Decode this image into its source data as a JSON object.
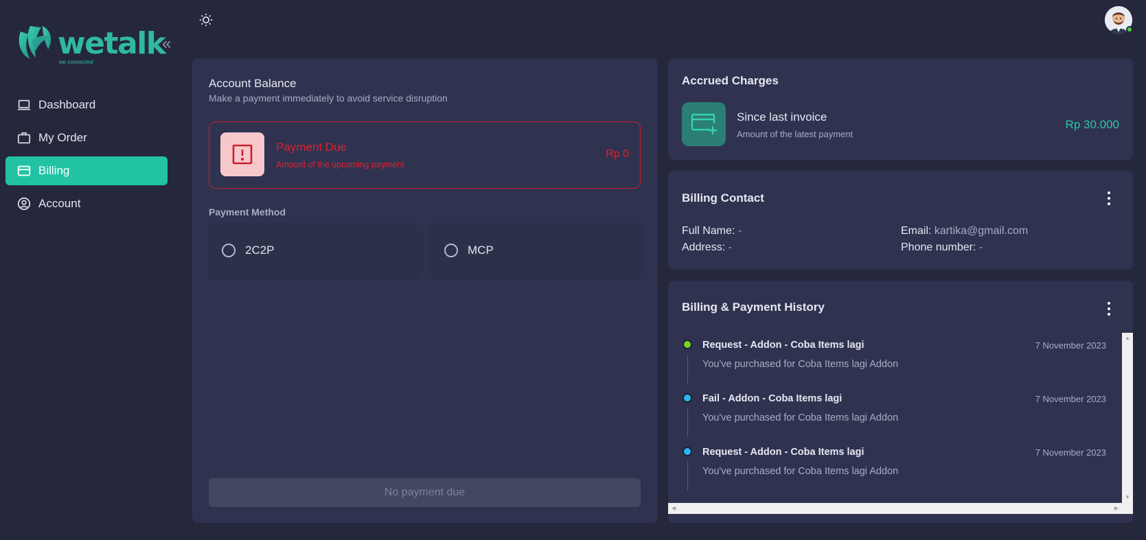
{
  "brand": {
    "name": "wetalk",
    "tagline": "we connected",
    "color": "#2fb9a3"
  },
  "sidebar": {
    "collapse_icon": "double-chevron-left-icon",
    "items": [
      {
        "label": "Dashboard",
        "icon": "laptop-icon",
        "active": false
      },
      {
        "label": "My Order",
        "icon": "briefcase-icon",
        "active": false
      },
      {
        "label": "Billing",
        "icon": "credit-card-icon",
        "active": true
      },
      {
        "label": "Account",
        "icon": "user-circle-icon",
        "active": false
      }
    ]
  },
  "topbar": {
    "theme_icon": "sun-icon",
    "status": "online"
  },
  "account_balance": {
    "title": "Account Balance",
    "subtitle": "Make a payment immediately to avoid service disruption",
    "payment_due": {
      "title": "Payment Due",
      "subtitle": "Amount of the upcoming payment",
      "amount": "Rp 0",
      "color": "#e0202f"
    },
    "payment_method_label": "Payment Method",
    "payment_methods": [
      {
        "label": "2C2P",
        "selected": false
      },
      {
        "label": "MCP",
        "selected": false
      }
    ],
    "action_label": "No payment due"
  },
  "accrued_charges": {
    "title": "Accrued Charges",
    "since_label": "Since last invoice",
    "subtitle": "Amount of the latest payment",
    "amount": "Rp 30.000",
    "accent": "#2fc4a7"
  },
  "billing_contact": {
    "title": "Billing Contact",
    "full_name": {
      "label": "Full Name:",
      "value": "-"
    },
    "address": {
      "label": "Address:",
      "value": "-"
    },
    "email": {
      "label": "Email:",
      "value": "kartika@gmail.com"
    },
    "phone": {
      "label": "Phone number:",
      "value": "-"
    }
  },
  "history": {
    "title": "Billing & Payment History",
    "entries": [
      {
        "title": "Request - Addon - Coba Items lagi",
        "date": "7 November 2023",
        "desc": "You've purchased for Coba Items lagi Addon",
        "dot_color": "#7ed321"
      },
      {
        "title": "Fail - Addon - Coba Items lagi",
        "date": "7 November 2023",
        "desc": "You've purchased for Coba Items lagi Addon",
        "dot_color": "#2bb7f0"
      },
      {
        "title": "Request - Addon - Coba Items lagi",
        "date": "7 November 2023",
        "desc": "You've purchased for Coba Items lagi Addon",
        "dot_color": "#2bb7f0"
      }
    ]
  }
}
